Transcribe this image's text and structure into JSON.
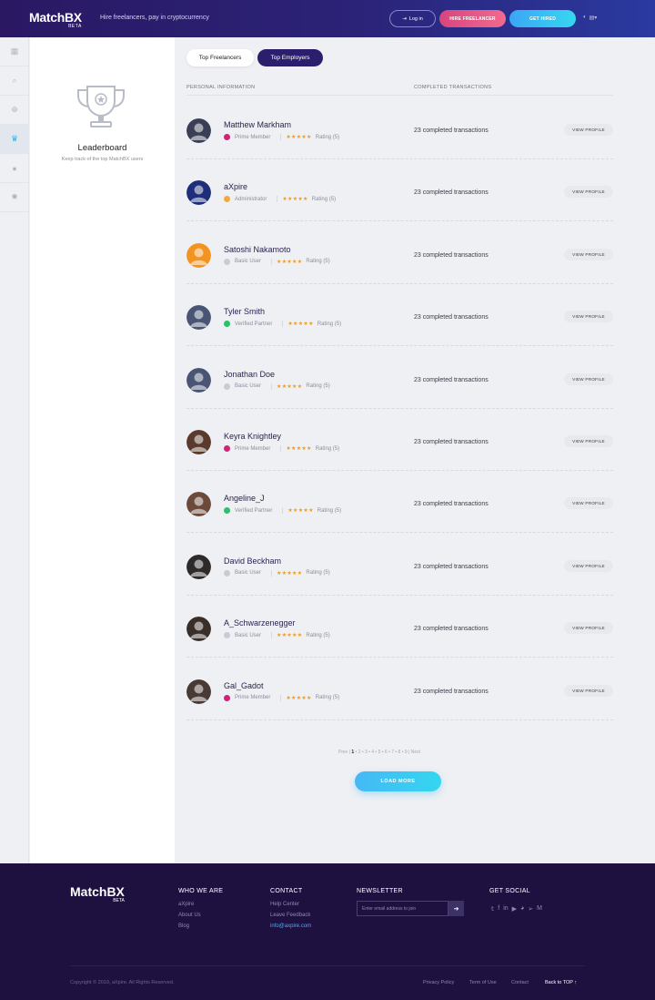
{
  "header": {
    "logo": "MatchBX",
    "beta": "BETA",
    "tagline": "Hire freelancers, pay in cryptocurrency",
    "login": "Log in",
    "hire": "HIRE FREELANCER",
    "hired": "GET HIRED"
  },
  "sidebar": {
    "items": [
      "dashboard-icon",
      "search-icon",
      "plus-icon",
      "trophy-icon",
      "user-icon",
      "gear-icon"
    ]
  },
  "leaderboard": {
    "title": "Leaderboard",
    "subtitle": "Keep track of the top MatchBX users"
  },
  "tabs": {
    "freelancers": "Top Freelancers",
    "employers": "Top Employers"
  },
  "table": {
    "col_personal": "PERSONAL INFORMATION",
    "col_transactions": "COMPLETED TRANSACTIONS",
    "rows": [
      {
        "name": "Matthew Markham",
        "role": "Prime Member",
        "role_color": "#d0237a",
        "stars": "★★★★★",
        "rating": "Rating (5)",
        "transactions": "23 completed transactions",
        "button": "VIEW PROFILE",
        "avatar_color": "#3b3f55"
      },
      {
        "name": "aXpire",
        "role": "Administrator",
        "role_color": "#f2a93b",
        "stars": "★★★★★",
        "rating": "Rating (5)",
        "transactions": "23 completed transactions",
        "button": "VIEW PROFILE",
        "avatar_color": "#1d2e7a"
      },
      {
        "name": "Satoshi Nakamoto",
        "role": "Basic User",
        "role_color": "#c8cbd2",
        "stars": "★★★★★",
        "rating": "Rating (5)",
        "transactions": "23 completed transactions",
        "button": "VIEW PROFILE",
        "avatar_color": "#f39321"
      },
      {
        "name": "Tyler Smith",
        "role": "Verified Partner",
        "role_color": "#2dc06b",
        "stars": "★★★★★",
        "rating": "Rating (5)",
        "transactions": "23 completed transactions",
        "button": "VIEW PROFILE",
        "avatar_color": "#4a5576"
      },
      {
        "name": "Jonathan Doe",
        "role": "Basic User",
        "role_color": "#c8cbd2",
        "stars": "★★★★★",
        "rating": "Rating (5)",
        "transactions": "23 completed transactions",
        "button": "VIEW PROFILE",
        "avatar_color": "#4a5576"
      },
      {
        "name": "Keyra Knightley",
        "role": "Prime Member",
        "role_color": "#d0237a",
        "stars": "★★★★★",
        "rating": "Rating (5)",
        "transactions": "23 completed transactions",
        "button": "VIEW PROFILE",
        "avatar_color": "#5b3a2e"
      },
      {
        "name": "Angeline_J",
        "role": "Verified Partner",
        "role_color": "#2dc06b",
        "stars": "★★★★★",
        "rating": "Rating (5)",
        "transactions": "23 completed transactions",
        "button": "VIEW PROFILE",
        "avatar_color": "#6b4a3a"
      },
      {
        "name": "David Beckham",
        "role": "Basic User",
        "role_color": "#c8cbd2",
        "stars": "★★★★★",
        "rating": "Rating (5)",
        "transactions": "23 completed transactions",
        "button": "VIEW PROFILE",
        "avatar_color": "#2e2a2a"
      },
      {
        "name": "A_Schwarzenegger",
        "role": "Basic User",
        "role_color": "#c8cbd2",
        "stars": "★★★★★",
        "rating": "Rating (5)",
        "transactions": "23 completed transactions",
        "button": "VIEW PROFILE",
        "avatar_color": "#3a2e28"
      },
      {
        "name": "Gal_Gadot",
        "role": "Prime Member",
        "role_color": "#d0237a",
        "stars": "★★★★★",
        "rating": "Rating (5)",
        "transactions": "23 completed transactions",
        "button": "VIEW PROFILE",
        "avatar_color": "#4a3a36"
      }
    ]
  },
  "pagination": {
    "prev": "Prev",
    "current": "1",
    "pages": "• 2 • 3 • 4 • 5 • 6 • 7 • 8 • 9",
    "next": "Next"
  },
  "load_more": "LOAD MORE",
  "footer": {
    "logo": "MatchBX",
    "beta": "BETA",
    "who_we_are": "WHO WE ARE",
    "who_links": [
      "aXpire",
      "About Us",
      "Blog"
    ],
    "contact": "CONTACT",
    "contact_links": [
      "Help Center",
      "Leave Feedback"
    ],
    "email": "info@axpire.com",
    "newsletter": "NEWSLETTER",
    "newsletter_placeholder": "Enter email address to join",
    "get_social": "GET SOCIAL",
    "copyright": "Copyright © 2019, aXpire. All Rights Reserved.",
    "privacy": "Privacy Policy",
    "terms": "Term of Use",
    "contact_bottom": "Contact",
    "back_top": "Back to TOP"
  }
}
